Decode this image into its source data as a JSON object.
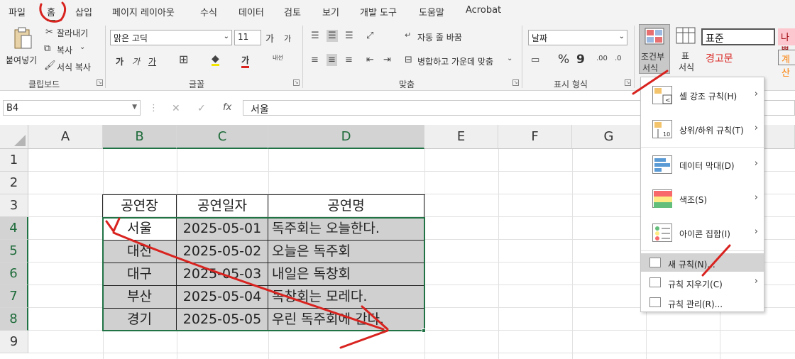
{
  "menubar": [
    "파일",
    "홈",
    "삽입",
    "페이지 레이아웃",
    "수식",
    "데이터",
    "검토",
    "보기",
    "개발 도구",
    "도움말",
    "Acrobat"
  ],
  "ribbon": {
    "clipboard": {
      "paste": "붙여넣기",
      "cut": "잘라내기",
      "copy": "복사",
      "format_painter": "서식 복사",
      "label": "클립보드"
    },
    "font": {
      "name": "맑은 고딕",
      "size": "11",
      "grow": "가",
      "shrink": "가",
      "bold": "가",
      "italic": "가",
      "underline": "가",
      "font_color": "가",
      "phonetic": "내선",
      "label": "글꼴"
    },
    "alignment": {
      "wrap": "자동 줄 바꿈",
      "merge": "병합하고 가운데 맞춤",
      "label": "맞춤"
    },
    "number": {
      "format": "날짜",
      "percent": "%",
      "comma": "9",
      "label": "표시 형식"
    },
    "styles": {
      "cond_format_1": "조건부",
      "cond_format_2": "서식",
      "table_1": "표",
      "table_2": "서식",
      "normal": "표준",
      "bad": "나쁨",
      "warning": "경고문",
      "calc": "계산"
    }
  },
  "formula": {
    "name_box": "B4",
    "cancel": "✕",
    "enter": "✓",
    "fx": "fx",
    "value": "서울"
  },
  "columns": [
    "A",
    "B",
    "C",
    "D",
    "E",
    "F",
    "G"
  ],
  "rows": [
    "1",
    "2",
    "3",
    "4",
    "5",
    "6",
    "7",
    "8",
    "9"
  ],
  "table": {
    "headers": [
      "공연장",
      "공연일자",
      "공연명"
    ],
    "rows": [
      [
        "서울",
        "2025-05-01",
        "독주회는 오늘한다."
      ],
      [
        "대전",
        "2025-05-02",
        "오늘은 독주회"
      ],
      [
        "대구",
        "2025-05-03",
        "내일은 독창회"
      ],
      [
        "부산",
        "2025-05-04",
        "독창회는 모레다."
      ],
      [
        "경기",
        "2025-05-05",
        "우린 독주회에 간다."
      ]
    ]
  },
  "cond_menu": {
    "items": [
      {
        "label": "셀 강조 규칙(H)",
        "icon": "highlight-cells-icon"
      },
      {
        "label": "상위/하위 규칙(T)",
        "icon": "top-bottom-icon"
      },
      {
        "label": "데이터 막대(D)",
        "icon": "data-bar-icon"
      },
      {
        "label": "색조(S)",
        "icon": "color-scale-icon"
      },
      {
        "label": "아이콘 집합(I)",
        "icon": "icon-set-icon"
      }
    ],
    "small_items": [
      {
        "label": "새 규칙(N)..."
      },
      {
        "label": "규칙 지우기(C)"
      },
      {
        "label": "규칙 관리(R)..."
      }
    ]
  },
  "colors": {
    "accent": "#217346",
    "annotation": "#d8231f",
    "selection_fill": "#d0d0d0"
  }
}
